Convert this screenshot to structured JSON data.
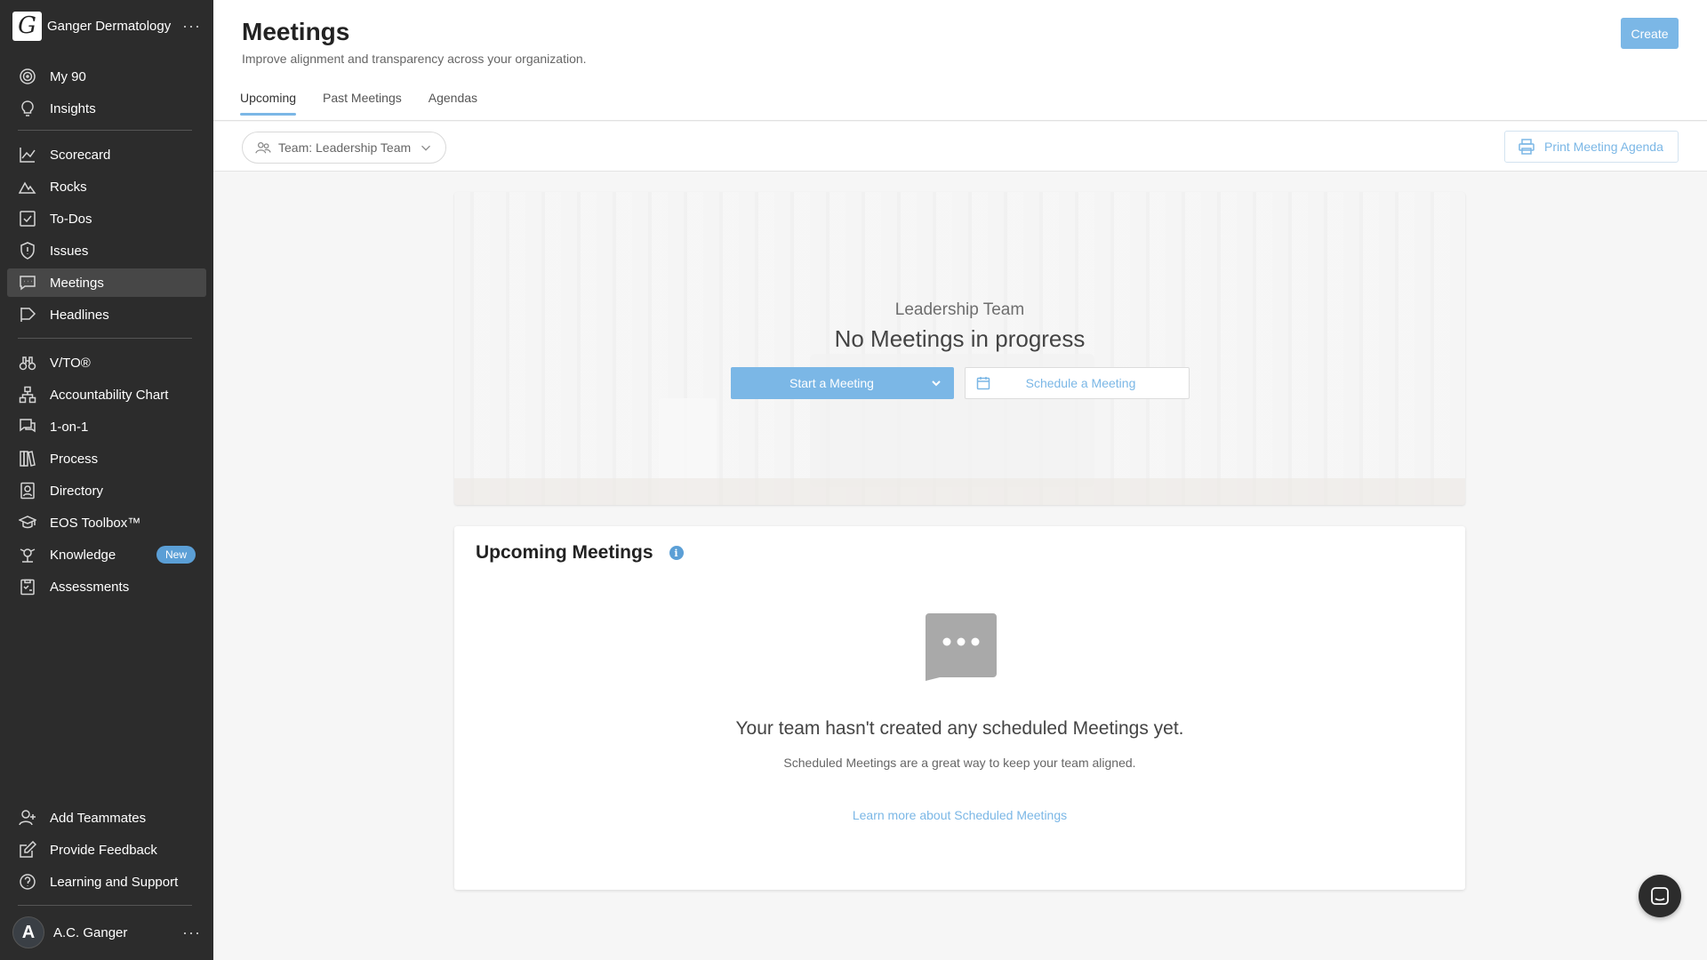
{
  "org": {
    "name": "Ganger Dermatology",
    "logo_letter": "G",
    "menu": "···"
  },
  "nav": {
    "group1": [
      {
        "label": "My 90",
        "icon": "target-icon"
      },
      {
        "label": "Insights",
        "icon": "lightbulb-icon"
      }
    ],
    "group2": [
      {
        "label": "Scorecard",
        "icon": "chart-line-icon"
      },
      {
        "label": "Rocks",
        "icon": "mountain-icon"
      },
      {
        "label": "To-Dos",
        "icon": "checkbox-icon"
      },
      {
        "label": "Issues",
        "icon": "shield-alert-icon"
      },
      {
        "label": "Meetings",
        "icon": "chat-icon",
        "active": true
      },
      {
        "label": "Headlines",
        "icon": "flag-icon"
      }
    ],
    "group3": [
      {
        "label": "V/TO®",
        "icon": "binoculars-icon"
      },
      {
        "label": "Accountability Chart",
        "icon": "org-chart-icon"
      },
      {
        "label": "1-on-1",
        "icon": "messages-icon"
      },
      {
        "label": "Process",
        "icon": "books-icon"
      },
      {
        "label": "Directory",
        "icon": "contact-icon"
      },
      {
        "label": "EOS Toolbox™",
        "icon": "graduation-cap-icon"
      },
      {
        "label": "Knowledge",
        "icon": "knowledge-icon",
        "badge": "New"
      },
      {
        "label": "Assessments",
        "icon": "clipboard-icon"
      }
    ],
    "bottom": [
      {
        "label": "Add Teammates",
        "icon": "user-plus-icon"
      },
      {
        "label": "Provide Feedback",
        "icon": "edit-icon"
      },
      {
        "label": "Learning and Support",
        "icon": "help-icon"
      }
    ]
  },
  "user": {
    "name": "A.C. Ganger",
    "initial": "A",
    "menu": "···"
  },
  "header": {
    "title": "Meetings",
    "subtitle": "Improve alignment and transparency across your organization.",
    "create_label": "Create",
    "tabs": [
      "Upcoming",
      "Past Meetings",
      "Agendas"
    ]
  },
  "toolbar": {
    "team_label": "Team: Leadership Team",
    "print_label": "Print Meeting Agenda"
  },
  "hero": {
    "team": "Leadership Team",
    "title": "No Meetings in progress",
    "start_label": "Start a Meeting",
    "schedule_label": "Schedule a Meeting"
  },
  "upcoming": {
    "title": "Upcoming Meetings",
    "info": "i",
    "empty_title": "Your team hasn't created any scheduled Meetings yet.",
    "empty_sub": "Scheduled Meetings are a great way to keep your team aligned.",
    "learn_link": "Learn more about Scheduled Meetings"
  },
  "colors": {
    "accent": "#7bb7e6",
    "sidebar": "#2c2c2c",
    "badge": "#5b9fd6"
  }
}
